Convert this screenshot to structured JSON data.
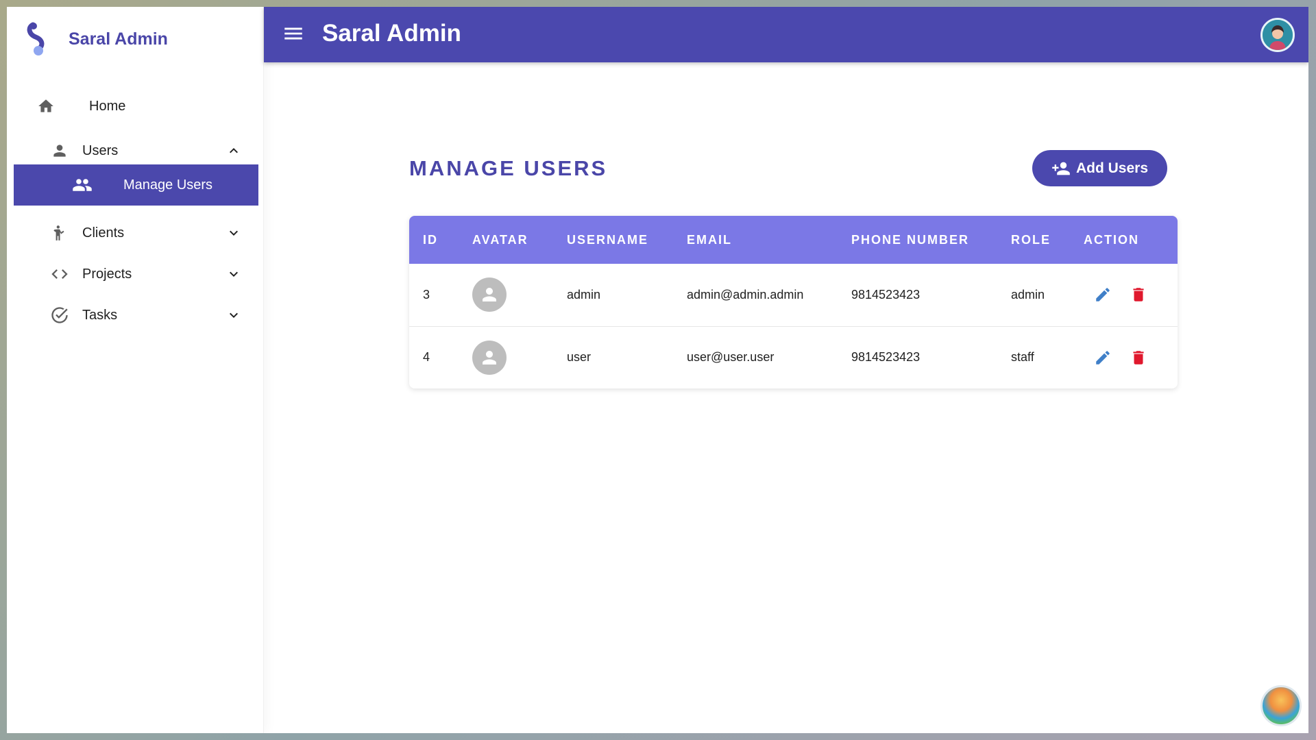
{
  "app": {
    "brand_name": "Saral Admin",
    "topbar_title": "Saral Admin",
    "accent_color": "#4b48ae",
    "header_color": "#7b78e6"
  },
  "sidebar": {
    "items": [
      {
        "label": "Home",
        "icon": "home-icon"
      },
      {
        "label": "Users",
        "icon": "person-icon",
        "expanded": true
      },
      {
        "label": "Manage Users",
        "icon": "people-icon",
        "active": true
      },
      {
        "label": "Clients",
        "icon": "person-wave-icon",
        "expanded": false
      },
      {
        "label": "Projects",
        "icon": "code-icon",
        "expanded": false
      },
      {
        "label": "Tasks",
        "icon": "check-circle-icon",
        "expanded": false
      }
    ]
  },
  "main": {
    "title": "MANAGE USERS",
    "add_button_label": "Add Users",
    "table": {
      "columns": [
        "ID",
        "AVATAR",
        "USERNAME",
        "EMAIL",
        "PHONE NUMBER",
        "ROLE",
        "ACTION"
      ],
      "rows": [
        {
          "id": "3",
          "username": "admin",
          "email": "admin@admin.admin",
          "phone": "9814523423",
          "role": "admin"
        },
        {
          "id": "4",
          "username": "user",
          "email": "user@user.user",
          "phone": "9814523423",
          "role": "staff"
        }
      ]
    }
  }
}
